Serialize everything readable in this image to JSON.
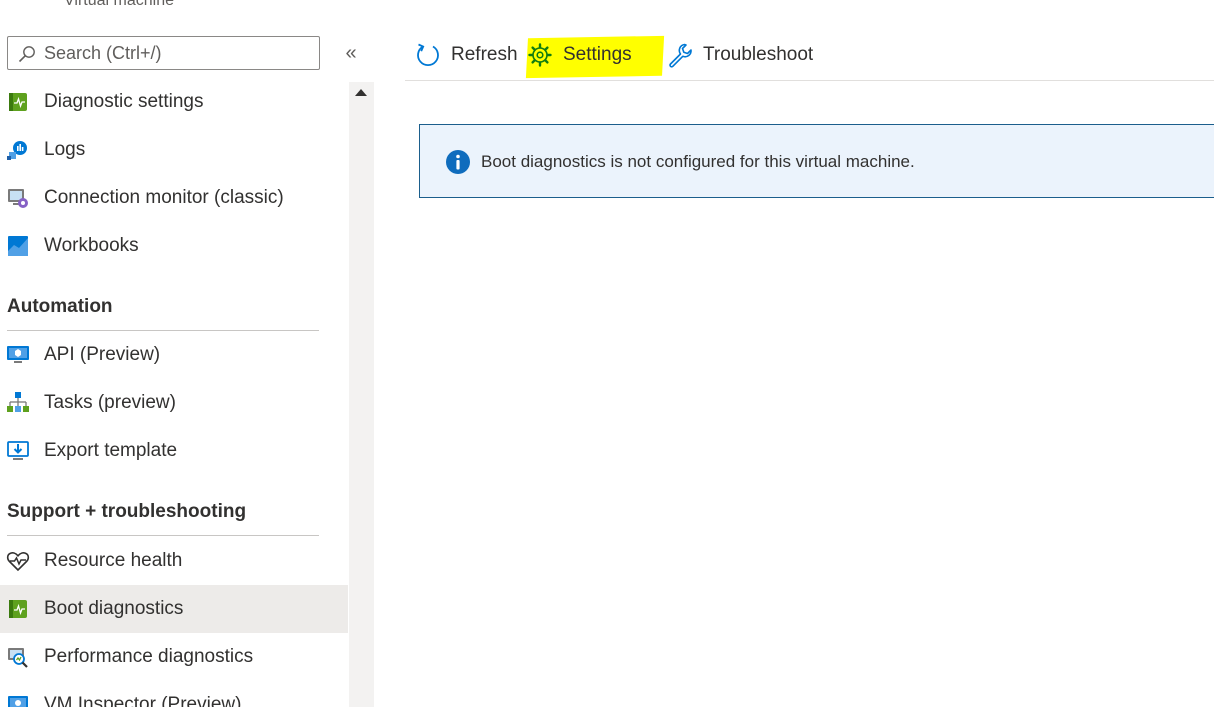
{
  "resource": {
    "subtitle": "Virtual machine"
  },
  "search": {
    "placeholder": "Search (Ctrl+/)"
  },
  "collapse": {
    "glyph": "«"
  },
  "nav": {
    "items_top": [
      {
        "label": "Diagnostic settings",
        "icon": "diagnostic-settings-icon"
      },
      {
        "label": "Logs",
        "icon": "logs-icon"
      },
      {
        "label": "Connection monitor (classic)",
        "icon": "connection-monitor-icon"
      },
      {
        "label": "Workbooks",
        "icon": "workbooks-icon"
      }
    ],
    "section_automation": "Automation",
    "items_automation": [
      {
        "label": "API (Preview)",
        "icon": "api-icon"
      },
      {
        "label": "Tasks (preview)",
        "icon": "tasks-icon"
      },
      {
        "label": "Export template",
        "icon": "export-template-icon"
      }
    ],
    "section_support": "Support + troubleshooting",
    "items_support": [
      {
        "label": "Resource health",
        "icon": "heart-pulse-icon"
      },
      {
        "label": "Boot diagnostics",
        "icon": "boot-diagnostics-icon",
        "selected": true
      },
      {
        "label": "Performance diagnostics",
        "icon": "performance-diagnostics-icon"
      },
      {
        "label": "VM Inspector (Preview)",
        "icon": "vm-inspector-icon"
      }
    ]
  },
  "toolbar": {
    "refresh_label": "Refresh",
    "settings_label": "Settings",
    "troubleshoot_label": "Troubleshoot"
  },
  "banner": {
    "message": "Boot diagnostics is not configured for this virtual machine."
  },
  "colors": {
    "accent": "#0078d4",
    "banner_bg": "#ebf3fc",
    "banner_border": "#1b5e8c",
    "selected_bg": "#edebe9",
    "highlight": "#ffff00"
  }
}
